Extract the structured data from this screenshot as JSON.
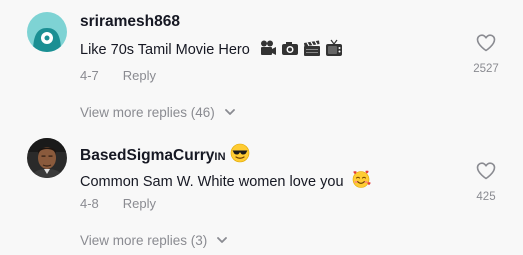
{
  "comments": [
    {
      "username": "sriramesh868",
      "text": "Like 70s Tamil Movie Hero",
      "text_icons": [
        "movie-camera-icon",
        "camera-icon",
        "clapper-board-icon",
        "television-icon"
      ],
      "date": "4-7",
      "reply_label": "Reply",
      "more_replies": "View more replies (46)",
      "likes": "2527"
    },
    {
      "username": "BasedSigmaCurry",
      "username_suffix": "IN",
      "username_icon": "sunglasses-face-icon",
      "text": "Common Sam W. White women love you",
      "text_icons": [
        "smiling-face-with-hearts-icon"
      ],
      "date": "4-8",
      "reply_label": "Reply",
      "more_replies": "View more replies (3)",
      "likes": "425"
    }
  ],
  "colors": {
    "background": "#f8f8f8",
    "username": "#161823",
    "secondary": "#8a8b91",
    "avatar1_bg": "#7ed3d4",
    "avatar1_figure": "#1b8f93"
  }
}
